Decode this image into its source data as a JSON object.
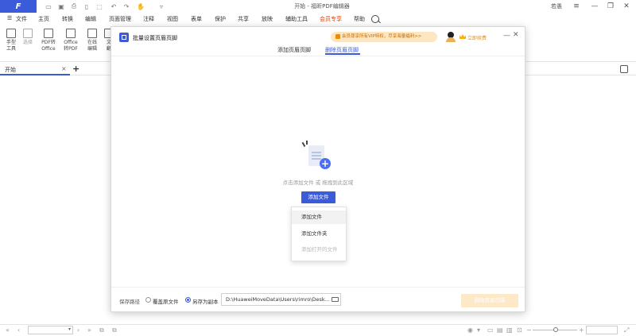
{
  "app": {
    "logo": "F",
    "title": "开始 - 福昕PDF编辑器",
    "user": "若愚"
  },
  "menu": {
    "items": [
      "文件",
      "主页",
      "转换",
      "编辑",
      "页面管理",
      "注释",
      "视图",
      "表单",
      "保护",
      "共享",
      "放映",
      "辅助工具",
      "会员专享",
      "帮助"
    ]
  },
  "ribbon": {
    "tools": [
      {
        "label": "手型\n工具"
      },
      {
        "label": "选择"
      },
      {
        "label": "PDF转\nOffice"
      },
      {
        "label": "Office\n转PDF"
      },
      {
        "label": "在线\n编辑"
      },
      {
        "label": "文\n翻"
      }
    ]
  },
  "tabs": {
    "doc_tab": "开始",
    "close": "×",
    "add": "+"
  },
  "dialog": {
    "title": "批量设置页眉页脚",
    "vip_banner": "会员尊享所有VIP特权，尽享海量福利>>",
    "open_vip": "立即续费",
    "tabs": [
      "添加页眉页脚",
      "删除页眉页脚"
    ],
    "active_tab": 1,
    "drop_hint": "点击添加文件 或 拖拽到此区域",
    "add_button": "添加文件",
    "dropdown": [
      "添加文件",
      "添加文件夹",
      "添加打开的文件"
    ],
    "save": {
      "label": "保存路径",
      "option_overwrite": "覆盖原文件",
      "option_copy": "另存为副本",
      "selected": "另存为副本",
      "path": "D:\\HuaweiMoveData\\Users\\rimro\\Desk..."
    },
    "delete_button": "删除页眉页脚"
  },
  "colors": {
    "accent": "#3b5bdb",
    "vip": "#f08c00",
    "disabled_btn": "#fde8c8"
  }
}
